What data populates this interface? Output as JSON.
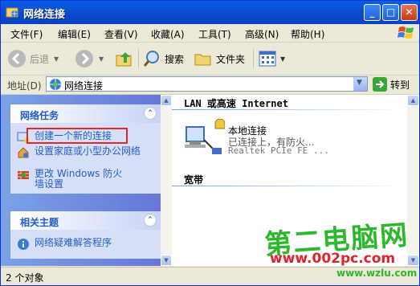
{
  "window": {
    "title": "网络连接"
  },
  "menu": [
    "文件(F)",
    "编辑(E)",
    "查看(V)",
    "收藏(A)",
    "工具(T)",
    "高级(N)",
    "帮助(H)"
  ],
  "toolbar": {
    "back": "后退",
    "search": "搜索",
    "folders": "文件夹"
  },
  "address": {
    "label": "地址(D)",
    "value": "网络连接",
    "go": "转到"
  },
  "network_tasks": {
    "title": "网络任务",
    "items": [
      "创建一个新的连接",
      "设置家庭或小型办公网络",
      "更改 Windows 防火墙设置"
    ]
  },
  "related": {
    "title": "相关主题",
    "items": [
      "网络疑难解答程序"
    ]
  },
  "groups": [
    {
      "header": "LAN 或高速 Internet"
    },
    {
      "header": "宽带"
    }
  ],
  "connection": {
    "name": "本地连接",
    "status": "已连接上，有防火...",
    "device": "Realtek PCIe FE ..."
  },
  "statusbar": {
    "text": "2 个对象"
  },
  "watermark": {
    "line1": "第二电脑网",
    "line2": "www.002pc.com",
    "line3": "www.wzlu.com"
  }
}
